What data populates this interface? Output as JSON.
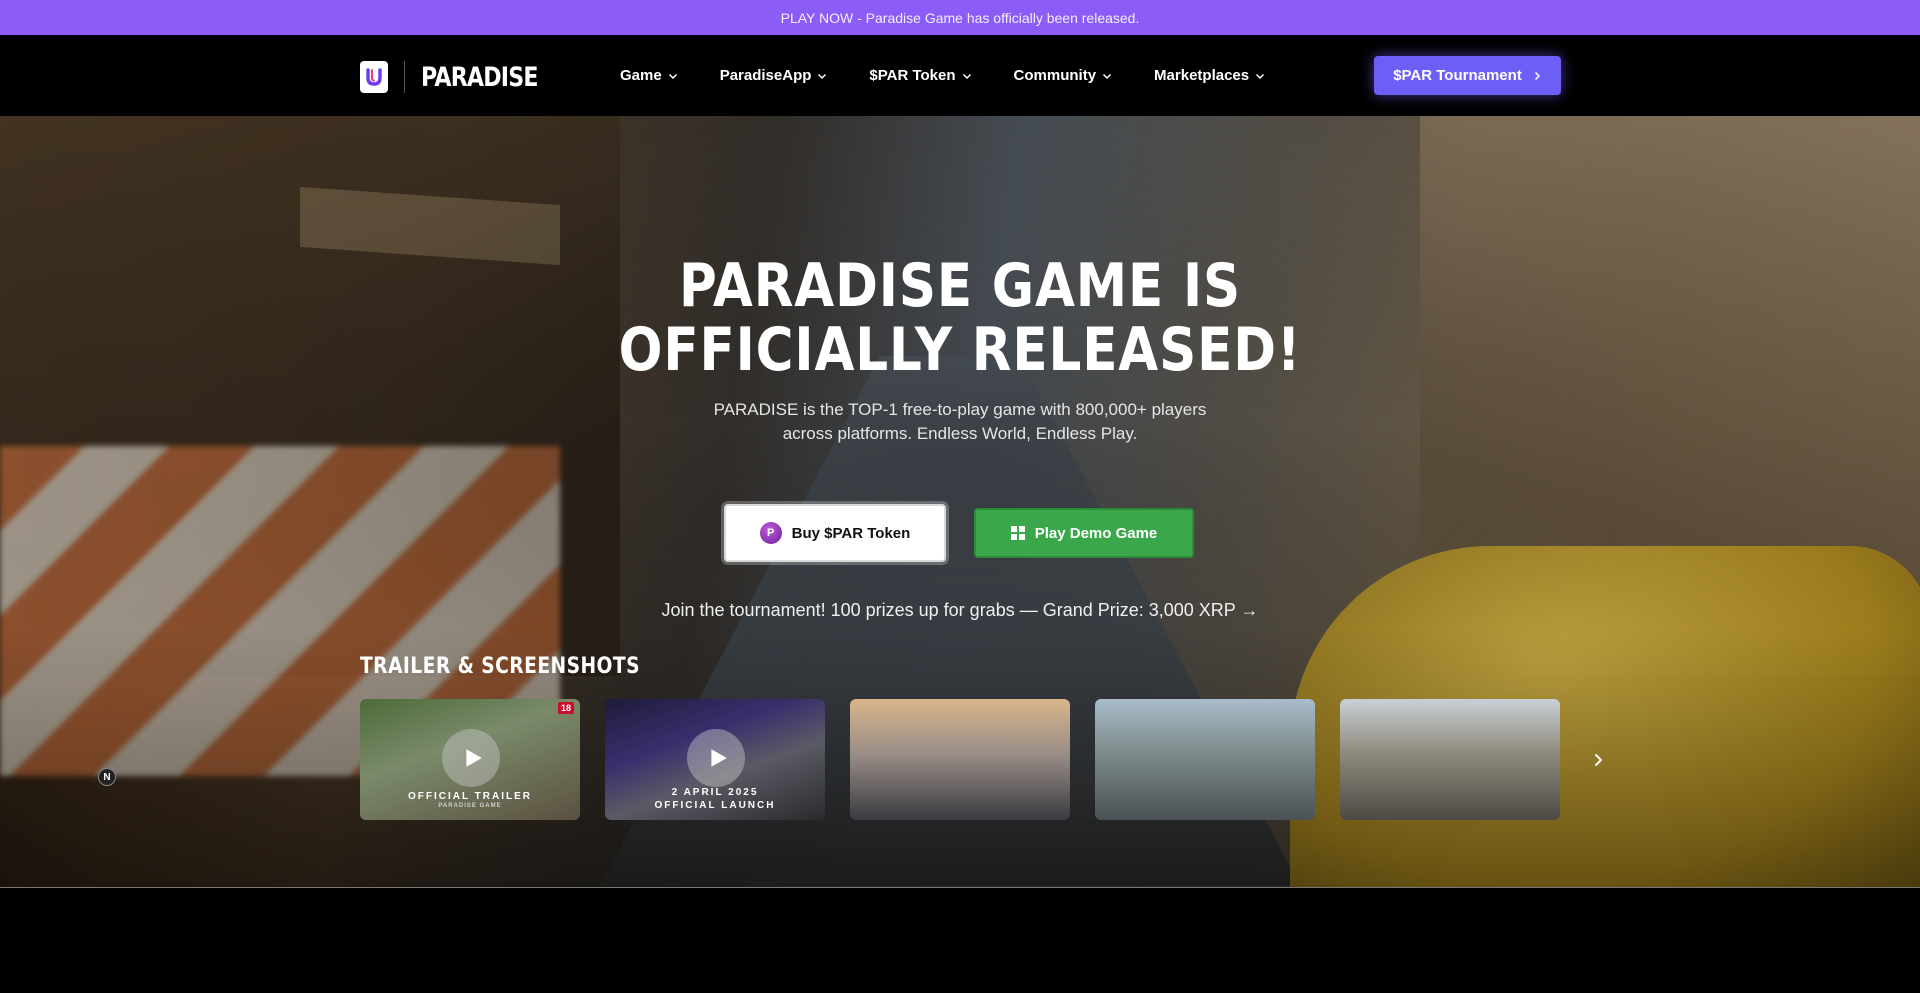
{
  "announcement": "PLAY NOW - Paradise Game has officially been released.",
  "brand": {
    "name": "PARADISE",
    "logo_icon": "paradise-u-logo"
  },
  "nav": {
    "items": [
      {
        "label": "Game"
      },
      {
        "label": "ParadiseApp"
      },
      {
        "label": "$PAR Token"
      },
      {
        "label": "Community"
      },
      {
        "label": "Marketplaces"
      }
    ],
    "cta_label": "$PAR Tournament"
  },
  "hero": {
    "title_line1": "PARADISE GAME IS",
    "title_line2": "OFFICIALLY RELEASED!",
    "subtitle_line1": "PARADISE is the TOP-1 free-to-play game with 800,000+ players",
    "subtitle_line2": "across platforms. Endless World, Endless Play.",
    "buy_label": "Buy $PAR Token",
    "coin_glyph": "P",
    "demo_label": "Play Demo Game",
    "tournament_text": "Join the tournament! 100 prizes up for grabs — Grand Prize: 3,000 XRP →",
    "compass": "N"
  },
  "gallery": {
    "title": "TRAILER & SCREENSHOTS",
    "thumbs": [
      {
        "caption": "OFFICIAL TRAILER",
        "badge": "18",
        "sub": "PARADISE GAME",
        "video": true
      },
      {
        "caption": "OFFICIAL LAUNCH",
        "date": "2 APRIL 2025",
        "video": true
      },
      {
        "caption": "",
        "video": false
      },
      {
        "caption": "",
        "video": false
      },
      {
        "caption": "",
        "video": false
      }
    ]
  },
  "colors": {
    "announcement_bg": "#8b5cf6",
    "cta_bg": "#6d5ef5",
    "demo_bg": "#3aa84a"
  }
}
